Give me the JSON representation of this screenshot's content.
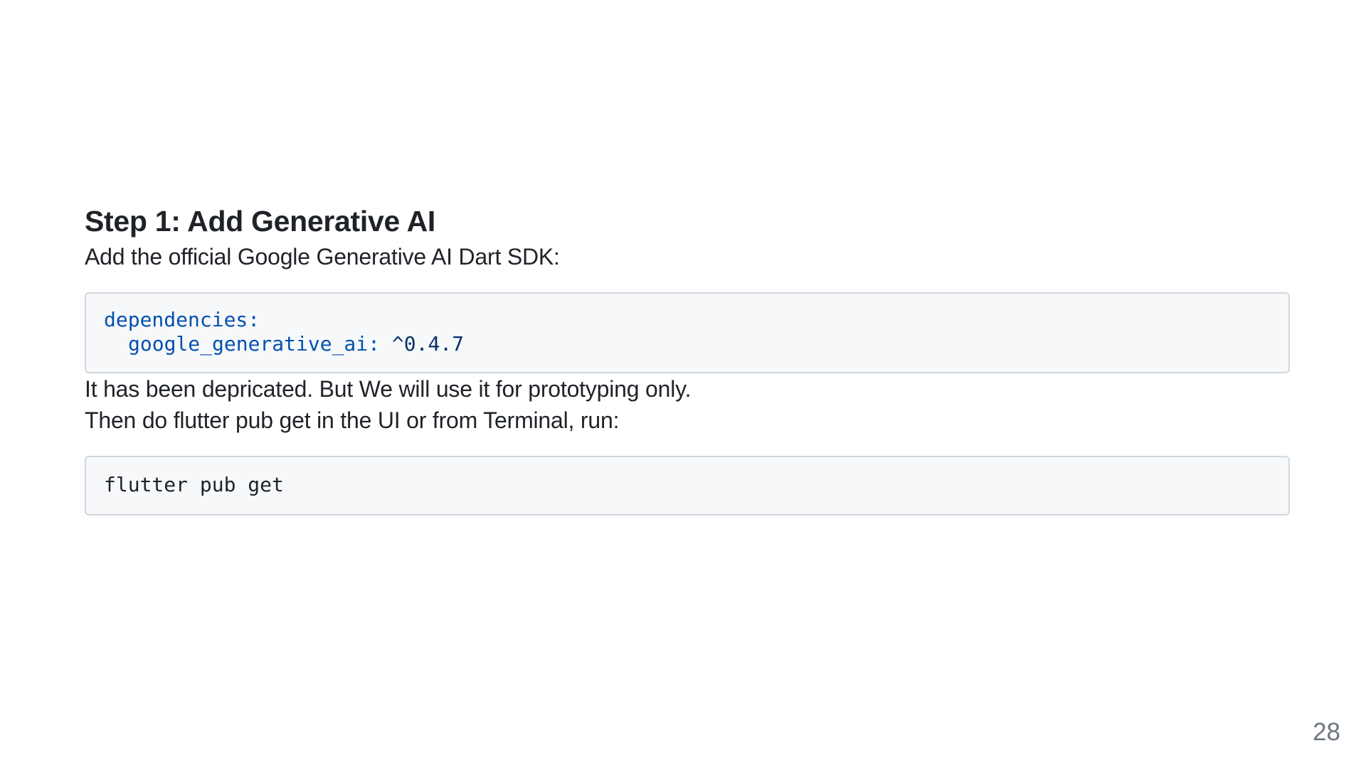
{
  "slide": {
    "title": "Step 1: Add Generative AI",
    "intro": "Add the official Google Generative AI Dart SDK:",
    "code_block_1": {
      "line1_key": "dependencies:",
      "line2_key": "google_generative_ai:",
      "line2_value": "^0.4.7"
    },
    "note": "It has been depricated. But We will use it for prototyping only.",
    "instruction": "Then do flutter pub get in the UI or from Terminal, run:",
    "code_block_2": {
      "command": "flutter pub get"
    },
    "page_number": "28"
  },
  "colors": {
    "background": "#ffffff",
    "text": "#1f2328",
    "code_background": "#f6f8fa",
    "code_border": "#d0d7de",
    "code_key": "#0550ae",
    "code_value": "#0a3069",
    "page_number": "#6e7781"
  }
}
